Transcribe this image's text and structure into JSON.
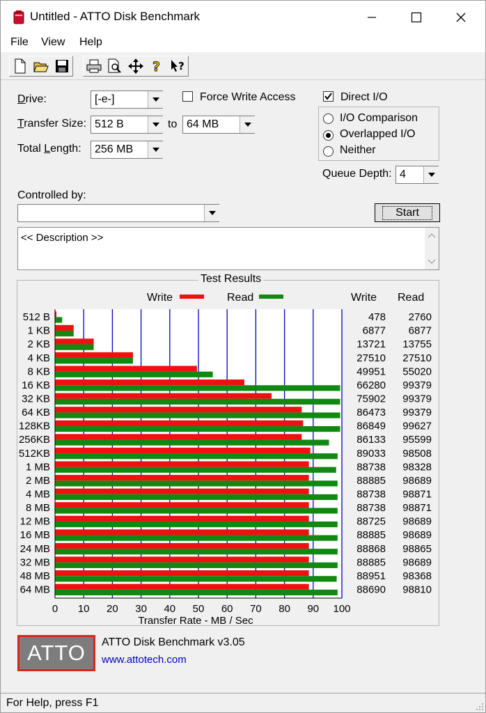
{
  "window": {
    "title": "Untitled - ATTO Disk Benchmark"
  },
  "menu": [
    "File",
    "View",
    "Help"
  ],
  "toolbar": {
    "buttons": [
      "new-file-icon",
      "open-folder-icon",
      "save-icon",
      "print-icon",
      "print-preview-icon",
      "move-icon",
      "help-icon",
      "context-help-icon"
    ]
  },
  "form": {
    "drive_label": "Drive:",
    "drive_value": "[-e-]",
    "force_write_label": "Force Write Access",
    "force_write_checked": false,
    "direct_io_label": "Direct I/O",
    "direct_io_checked": true,
    "transfer_size_label": "Transfer Size:",
    "transfer_from": "512 B",
    "to_label": "to",
    "transfer_to": "64 MB",
    "total_length_label": "Total Length:",
    "total_length_value": "256 MB",
    "io_options": [
      {
        "label": "I/O Comparison",
        "selected": false
      },
      {
        "label": "Overlapped I/O",
        "selected": true
      },
      {
        "label": "Neither",
        "selected": false
      }
    ],
    "queue_depth_label": "Queue Depth:",
    "queue_depth_value": "4",
    "controlled_by_label": "Controlled by:",
    "controlled_by_value": "",
    "start_label": "Start",
    "description": "<< Description >>"
  },
  "results": {
    "group_title": "Test Results",
    "legend_write": "Write",
    "legend_read": "Read",
    "col_write": "Write",
    "col_read": "Read"
  },
  "chart_data": {
    "type": "bar",
    "orientation": "horizontal",
    "xlabel": "Transfer Rate - MB / Sec",
    "xlim": [
      0,
      100
    ],
    "xticks": [
      0,
      10,
      20,
      30,
      40,
      50,
      60,
      70,
      80,
      90,
      100
    ],
    "grid": true,
    "colors": {
      "write": "#ee1111",
      "read": "#118811",
      "grid": "#0000cc"
    },
    "categories": [
      "512 B",
      "1 KB",
      "2 KB",
      "4 KB",
      "8 KB",
      "16 KB",
      "32 KB",
      "64 KB",
      "128KB",
      "256KB",
      "512KB",
      "1 MB",
      "2 MB",
      "4 MB",
      "8 MB",
      "12 MB",
      "16 MB",
      "24 MB",
      "32 MB",
      "48 MB",
      "64 MB"
    ],
    "series": [
      {
        "name": "Write",
        "bar_values": [
          0.5,
          6.5,
          13.5,
          27.2,
          49.5,
          66,
          75.5,
          86,
          86.5,
          86,
          89,
          88.5,
          88.5,
          88.5,
          88.5,
          88.5,
          88.5,
          88.5,
          88.5,
          88.5,
          88.5
        ],
        "labels": [
          "478",
          "6877",
          "13721",
          "27510",
          "49951",
          "66280",
          "75902",
          "86473",
          "86849",
          "86133",
          "89033",
          "88738",
          "88885",
          "88738",
          "88738",
          "88725",
          "88885",
          "88868",
          "88885",
          "88951",
          "88690"
        ]
      },
      {
        "name": "Read",
        "bar_values": [
          2.5,
          6.5,
          13.5,
          27.2,
          55,
          99.4,
          99.4,
          99.4,
          99.4,
          95.5,
          98.5,
          98,
          98.5,
          98.5,
          98.5,
          98.5,
          98.5,
          98.5,
          98.5,
          98.2,
          98.5
        ],
        "labels": [
          "2760",
          "6877",
          "13755",
          "27510",
          "55020",
          "99379",
          "99379",
          "99379",
          "99627",
          "95599",
          "98508",
          "98328",
          "98689",
          "98871",
          "98871",
          "98689",
          "98689",
          "98865",
          "98689",
          "98368",
          "98810"
        ]
      }
    ]
  },
  "footer": {
    "logo_text": "ATTO",
    "version": "ATTO Disk Benchmark v3.05",
    "website": "www.attotech.com"
  },
  "status": {
    "text": "For Help, press F1"
  }
}
